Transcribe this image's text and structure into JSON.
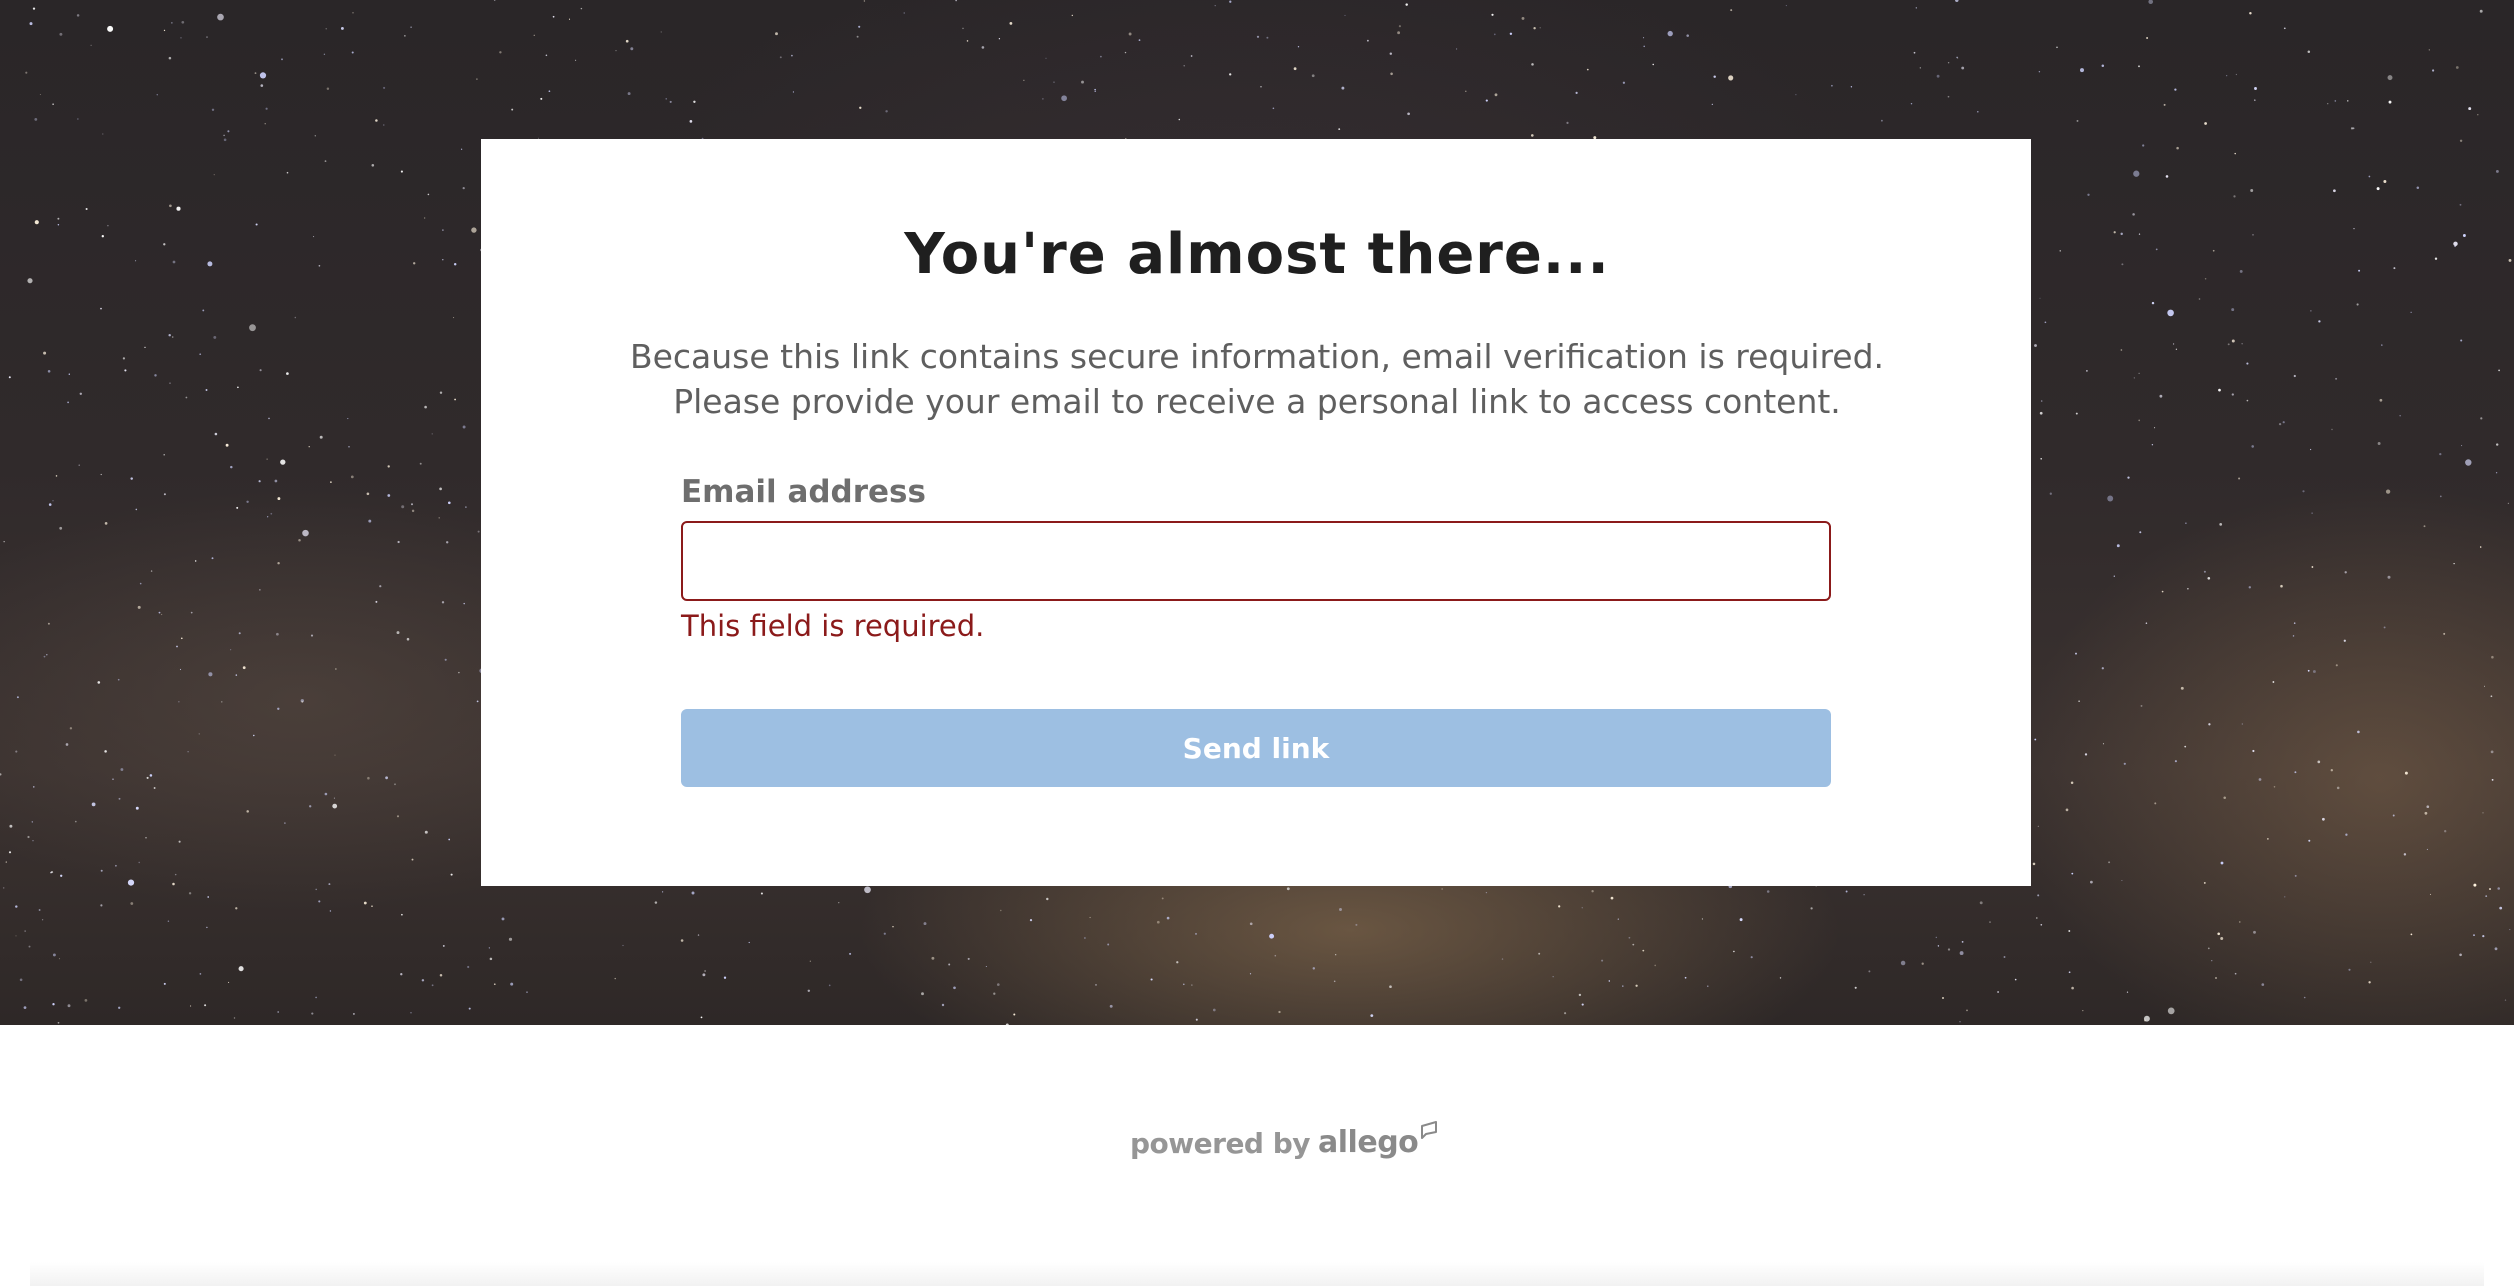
{
  "card": {
    "title": "You're almost there...",
    "description_line1": "Because this link contains secure information, email verification is required.",
    "description_line2": "Please provide your email to receive a personal link to access content."
  },
  "form": {
    "email_label": "Email address",
    "email_value": "",
    "error_message": "This field is required.",
    "submit_label": "Send link"
  },
  "footer": {
    "powered_by": "powered by",
    "brand": "allego",
    "brand_mark_icon": "speech-bubble-icon"
  },
  "colors": {
    "error": "#8b1a1a",
    "button_disabled": "#9dbfe2",
    "title": "#1f1f1f",
    "text": "#5f5f5f"
  }
}
